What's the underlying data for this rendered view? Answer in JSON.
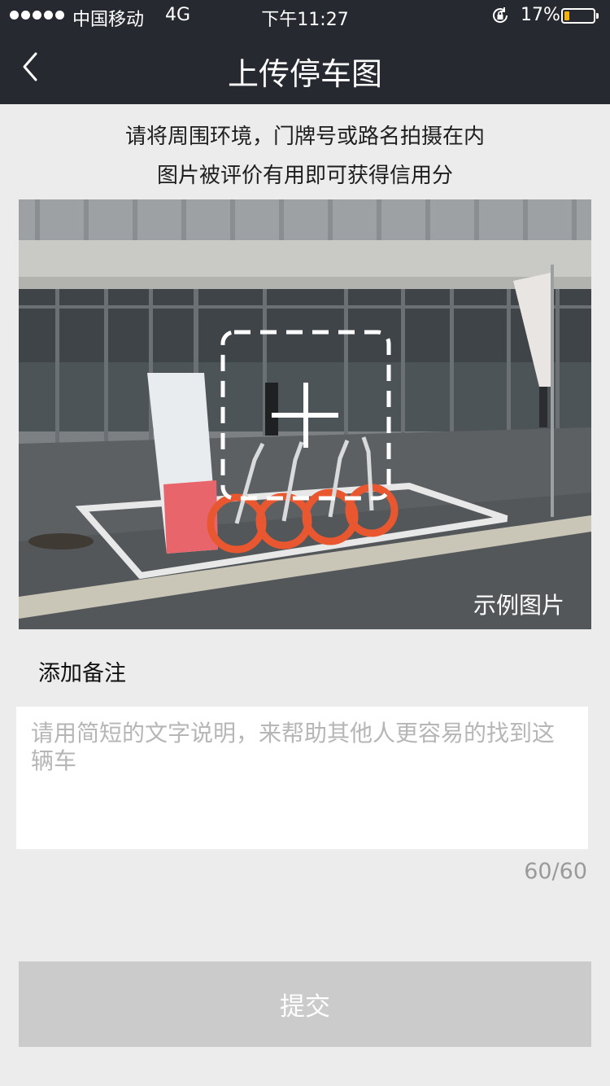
{
  "status_bar": {
    "carrier": "中国移动",
    "network": "4G",
    "time": "下午11:27",
    "battery_percent": "17%",
    "battery_level": 0.17,
    "battery_color": "#f5b10d"
  },
  "nav": {
    "back_icon": "chevron-left-icon",
    "title": "上传停车图"
  },
  "instructions": {
    "line1": "请将周围环境，门牌号或路名拍摄在内",
    "line2": "图片被评价有用即可获得信用分"
  },
  "photo": {
    "example_label": "示例图片",
    "add_icon": "add-photo-icon"
  },
  "remark": {
    "label": "添加备注",
    "placeholder": "请用简短的文字说明，来帮助其他人更容易的找到这辆车",
    "value": "",
    "counter": "60/60"
  },
  "submit": {
    "label": "提交",
    "color": "#cbcbcb"
  }
}
